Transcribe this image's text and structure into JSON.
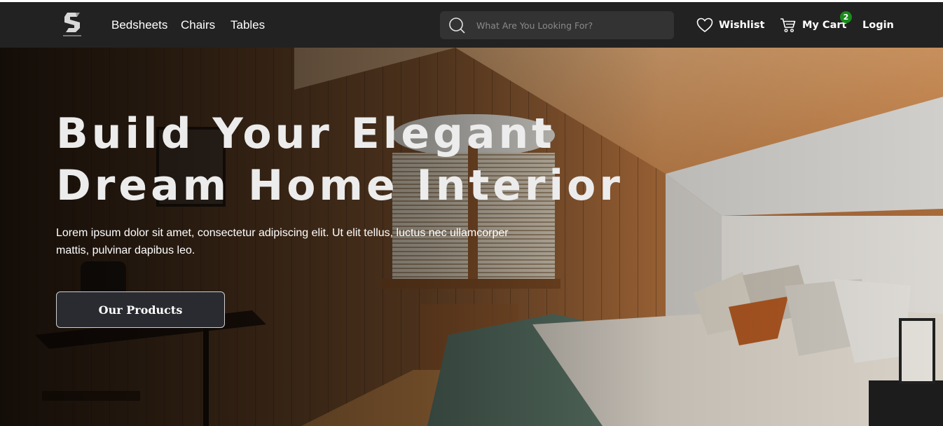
{
  "colors": {
    "navbar_bg": "#222222",
    "search_bg": "#333333",
    "badge_bg": "#1a8a1a",
    "cta_bg": "#2a2b30"
  },
  "brand": {
    "logo": "spacehome-logo-icon"
  },
  "nav": {
    "links": [
      "Bedsheets",
      "Chairs",
      "Tables"
    ]
  },
  "search": {
    "placeholder": "What Are You Looking For?",
    "icon": "search-icon"
  },
  "actions": {
    "wishlist_label": "Wishlist",
    "cart_label": "My Cart",
    "cart_count": "2",
    "login_label": "Login"
  },
  "hero": {
    "title_line1": "Build Your Elegant",
    "title_line2": "Dream Home Interior",
    "text_line1": "Lorem ipsum dolor sit amet, consectetur adipiscing elit. Ut elit tellus, luctus nec ullamcorper",
    "text_line2": "mattis, pulvinar dapibus leo.",
    "cta_label": "Our Products",
    "image": "attic-bedroom-photo"
  }
}
